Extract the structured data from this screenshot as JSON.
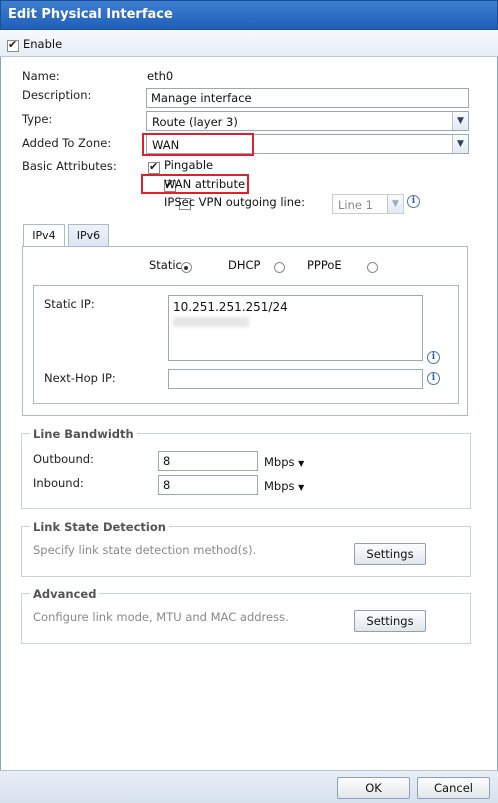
{
  "dialog": {
    "title": "Edit Physical Interface"
  },
  "enable": {
    "label": "Enable",
    "checked": true
  },
  "form": {
    "name_label": "Name:",
    "name_value": "eth0",
    "description_label": "Description:",
    "description_value": "Manage interface",
    "type_label": "Type:",
    "type_value": "Route (layer 3)",
    "zone_label": "Added To Zone:",
    "zone_value": "WAN",
    "basic_label": "Basic Attributes:",
    "pingable_label": "Pingable",
    "wan_attr_label": "WAN attribute",
    "ipsec_label": "IPSec VPN outgoing line:",
    "ipsec_value": "Line 1"
  },
  "tabs": [
    {
      "label": "IPv4"
    },
    {
      "label": "IPv6"
    }
  ],
  "ipv4": {
    "modes": {
      "static": "Static",
      "dhcp": "DHCP",
      "pppoe": "PPPoE"
    },
    "static_ip_label": "Static IP:",
    "static_ip_value": "10.251.251.251/24",
    "next_hop_label": "Next-Hop IP:",
    "next_hop_value": ""
  },
  "bandwidth": {
    "legend": "Line Bandwidth",
    "outbound_label": "Outbound:",
    "outbound_value": "8",
    "inbound_label": "Inbound:",
    "inbound_value": "8",
    "unit": "Mbps"
  },
  "link_state": {
    "legend": "Link State Detection",
    "desc": "Specify link state detection method(s).",
    "button": "Settings"
  },
  "advanced": {
    "legend": "Advanced",
    "desc": "Configure link mode, MTU and MAC address.",
    "button": "Settings"
  },
  "footer": {
    "ok": "OK",
    "cancel": "Cancel"
  },
  "colors": {
    "titlebar": "#2a6cc4",
    "highlight": "#e0202a"
  }
}
